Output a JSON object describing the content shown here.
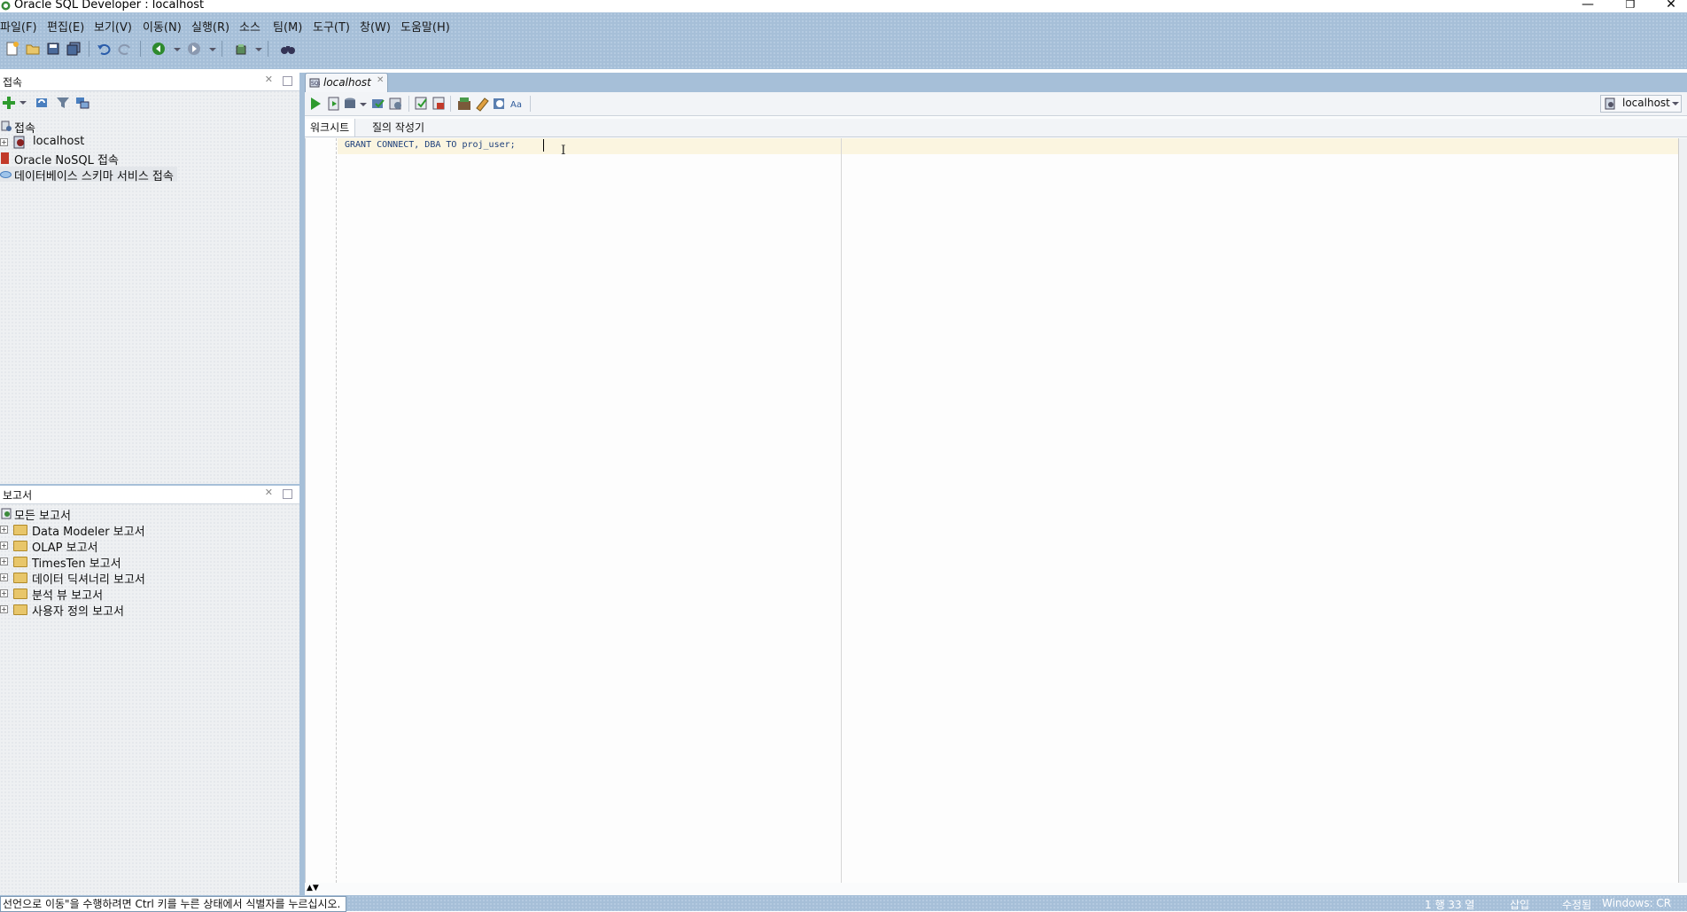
{
  "window": {
    "title": "Oracle SQL Developer : localhost",
    "min": "—",
    "restore": "❐",
    "close": "✕"
  },
  "menu": [
    "파일(F)",
    "편집(E)",
    "보기(V)",
    "이동(N)",
    "실행(R)",
    "소스",
    "팀(M)",
    "도구(T)",
    "창(W)",
    "도움말(H)"
  ],
  "connections_panel": {
    "title": "접속",
    "root": "접속",
    "items": [
      "localhost",
      "Oracle NoSQL 접속",
      "데이터베이스 스키마 서비스 접속"
    ]
  },
  "reports_panel": {
    "title": "보고서",
    "root": "모든 보고서",
    "items": [
      "Data Modeler 보고서",
      "OLAP 보고서",
      "TimesTen 보고서",
      "데이터 딕셔너리 보고서",
      "분석 뷰 보고서",
      "사용자 정의 보고서"
    ]
  },
  "editor": {
    "tab_label": "localhost",
    "connection": "localhost",
    "subtabs": [
      "워크시트",
      "질의 작성기"
    ],
    "code": "GRANT CONNECT, DBA TO proj_user;"
  },
  "status": {
    "message": "선언으로 이동\"을 수행하려면 Ctrl 키를 누른 상태에서 식별자를 누르십시오.",
    "position": "1 행 33 열",
    "insert_mode": "삽입",
    "modified": "수정됨",
    "line_ending": "Windows: CR"
  },
  "colors": {
    "chrome": "#a6bfd8",
    "panel": "#eef0f2",
    "current_line": "#fbf5e0",
    "code_text": "#1c3e7a"
  }
}
